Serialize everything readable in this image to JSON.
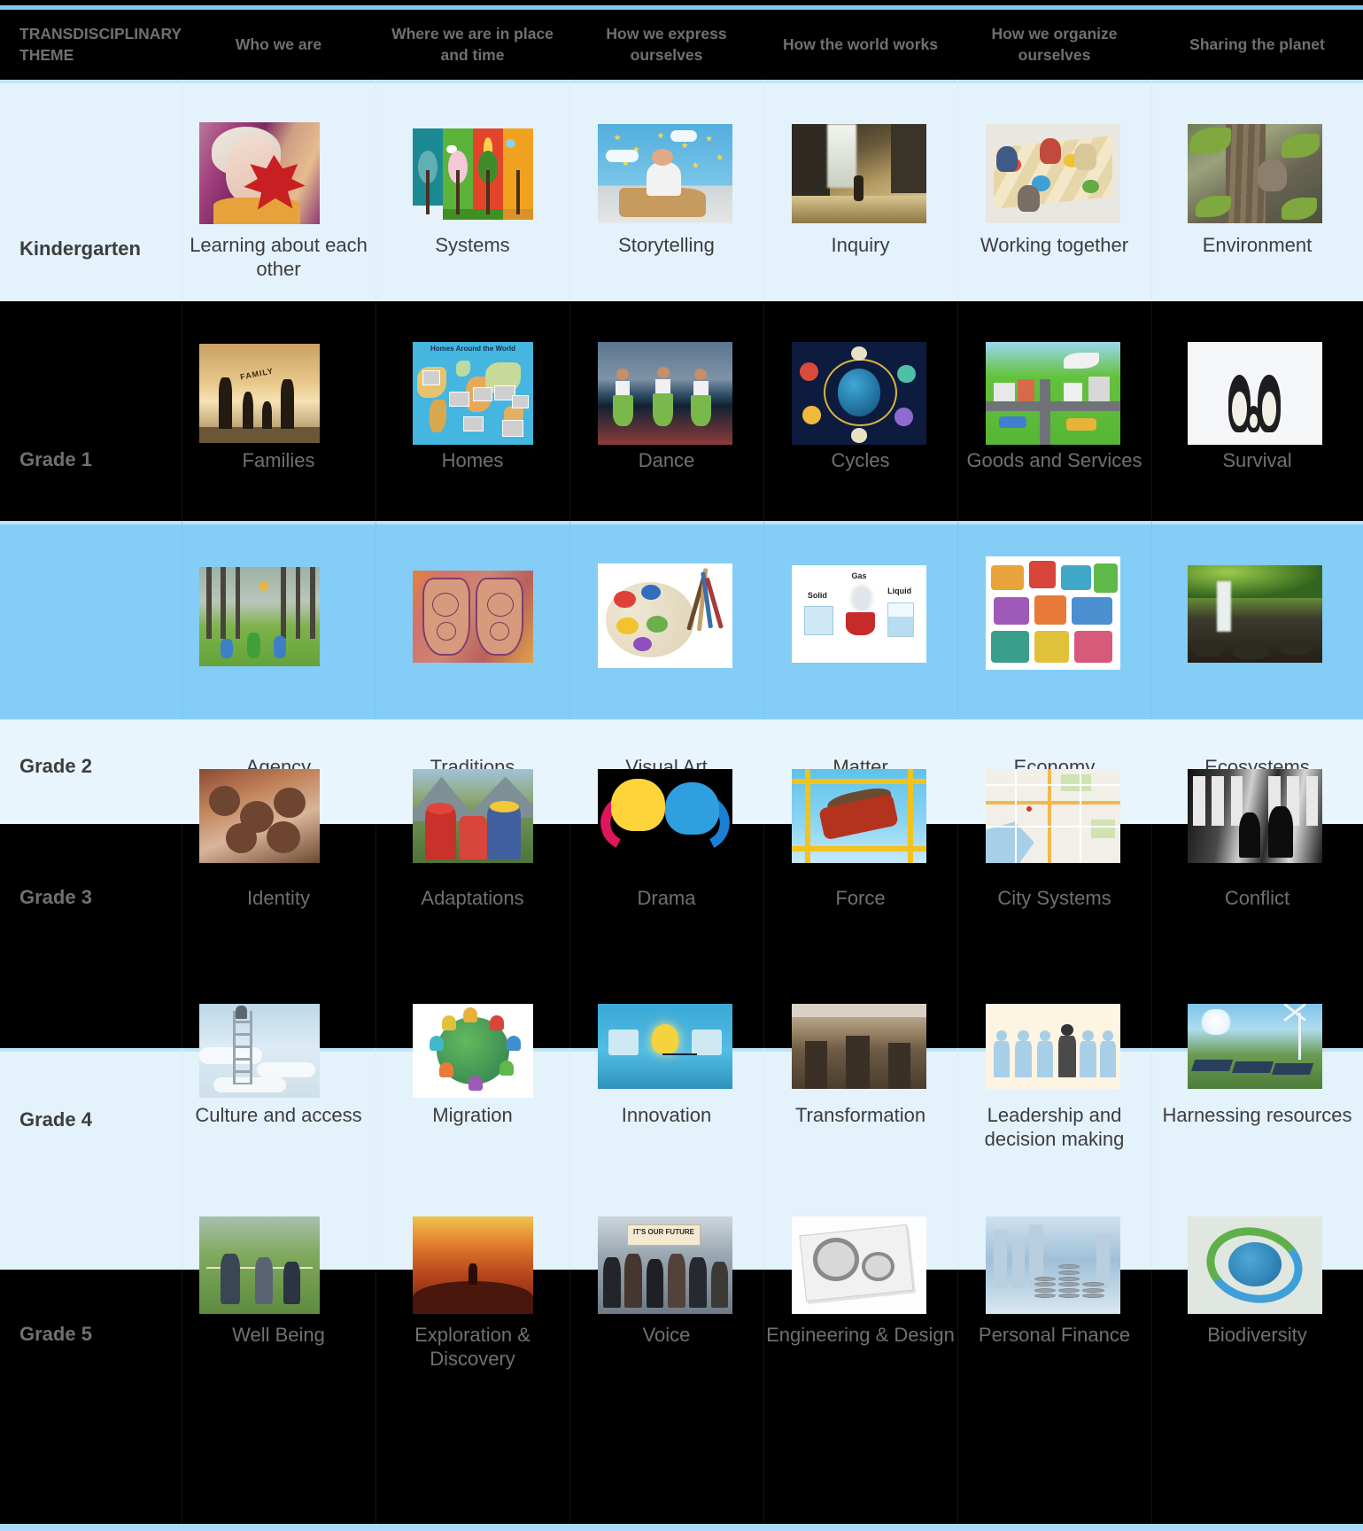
{
  "meta": {
    "accent_blue": "#83cdf6",
    "light_blue": "#e4f2fc",
    "rule_blue": "#7ec9ef",
    "dark_bg": "#000000",
    "dark_text": "#6f7073",
    "light_text": "#3d3d3d"
  },
  "header": {
    "columns": [
      "TRANSDISCIPLINARY THEME",
      "Who we are",
      "Where we are in place and time",
      "How we express ourselves",
      "How the world works",
      "How we organize ourselves",
      "Sharing the planet"
    ]
  },
  "rows": [
    {
      "grade": "Kindergarten",
      "theme": "light",
      "cells": [
        {
          "label": "Learning about each other",
          "image": "girl-with-red-leaf-photo"
        },
        {
          "label": "Systems",
          "image": "four-seasons-trees-illustration"
        },
        {
          "label": "Storytelling",
          "image": "child-in-cardboard-boat-photo"
        },
        {
          "label": "Inquiry",
          "image": "waterfall-exploration-photo"
        },
        {
          "label": "Working together",
          "image": "children-collaborative-floor-art-photo"
        },
        {
          "label": "Environment",
          "image": "squirrel-on-tree-photo"
        }
      ]
    },
    {
      "grade": "Grade 1",
      "theme": "dark",
      "cells": [
        {
          "label": "Families",
          "image": "family-silhouette-sunset-photo"
        },
        {
          "label": "Homes",
          "image": "homes-around-the-world-map"
        },
        {
          "label": "Dance",
          "image": "hula-dancers-photo"
        },
        {
          "label": "Cycles",
          "image": "cycles-collage-illustration"
        },
        {
          "label": "Goods and Services",
          "image": "goods-and-services-town-illustration"
        },
        {
          "label": "Survival",
          "image": "penguin-family-photo"
        }
      ]
    },
    {
      "grade": "Grade 2",
      "theme": "bright",
      "cells": [
        {
          "label": "Agency",
          "image": "children-playing-in-forest-photo"
        },
        {
          "label": "Traditions",
          "image": "henna-decorated-hands-photo"
        },
        {
          "label": "Visual Art",
          "image": "paint-palette-and-brushes-photo"
        },
        {
          "label": "Matter",
          "image": "solid-gas-liquid-diagram"
        },
        {
          "label": "Economy",
          "image": "economy-town-illustration"
        },
        {
          "label": "Ecosystems",
          "image": "forest-waterfall-photo"
        }
      ]
    },
    {
      "grade": "Grade 3",
      "theme": "dark",
      "cells": [
        {
          "label": "Identity",
          "image": "group-of-children-faces-photo"
        },
        {
          "label": "Adaptations",
          "image": "andean-girls-traditional-dress-photo"
        },
        {
          "label": "Drama",
          "image": "comedy-tragedy-masks-icon"
        },
        {
          "label": "Force",
          "image": "roller-coaster-ride-photo"
        },
        {
          "label": "City Systems",
          "image": "city-street-map"
        },
        {
          "label": "Conflict",
          "image": "segregated-bus-black-and-white-photo"
        }
      ]
    },
    {
      "grade": "Grade 4",
      "theme": "light",
      "cells": [
        {
          "label": "Culture and access",
          "image": "ladder-into-clouds-photo"
        },
        {
          "label": "Migration",
          "image": "globe-of-diverse-people-illustration"
        },
        {
          "label": "Innovation",
          "image": "lightbulb-among-ice-cubes-photo"
        },
        {
          "label": "Transformation",
          "image": "eroded-canyon-landscape-photo"
        },
        {
          "label": "Leadership and decision making",
          "image": "leader-raising-arms-in-group-icon"
        },
        {
          "label": "Harnessing resources",
          "image": "solar-panels-and-wind-turbine-photo"
        }
      ]
    },
    {
      "grade": "Grade 5",
      "theme": "dark",
      "cells": [
        {
          "label": "Well Being",
          "image": "tug-of-war-outdoors-photo"
        },
        {
          "label": "Exploration & Discovery",
          "image": "hiker-at-sunset-photo"
        },
        {
          "label": "Voice",
          "image": "protest-its-our-future-sign-photo"
        },
        {
          "label": "Engineering & Design",
          "image": "technical-drawings-and-gears-photo"
        },
        {
          "label": "Personal Finance",
          "image": "coin-stacks-and-city-photo"
        },
        {
          "label": "Biodiversity",
          "image": "recycling-arrows-around-globe-icon"
        }
      ]
    }
  ],
  "signs": {
    "homes_map_title": "Homes Around the World",
    "family_banner": "FAMILY",
    "matter_solid": "Solid",
    "matter_gas": "Gas",
    "matter_liquid": "Liquid",
    "protest_sign": "IT'S OUR FUTURE"
  }
}
